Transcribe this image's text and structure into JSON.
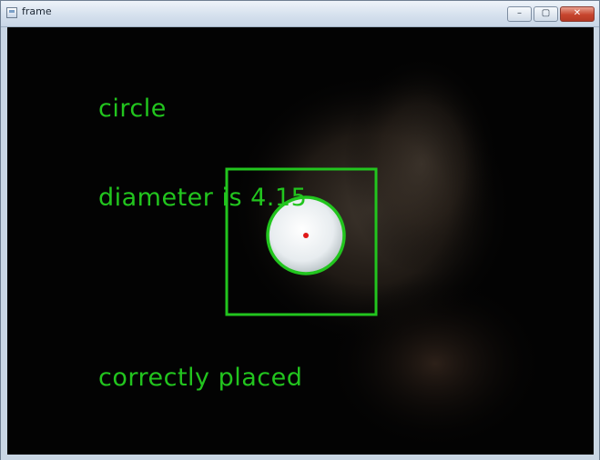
{
  "window": {
    "title": "frame",
    "controls": {
      "minimize": "–",
      "maximize": "▢",
      "close": "✕"
    }
  },
  "overlay": {
    "shape_label": "circle",
    "diameter_label": "diameter is 4.15",
    "status_label": "correctly placed"
  },
  "colors": {
    "overlay_green": "#22c51e",
    "center_marker": "#e01818",
    "frame_background": "#030303"
  },
  "icons": {
    "app": "window-app-icon",
    "minimize": "minimize-icon",
    "maximize": "maximize-icon",
    "close": "close-icon"
  }
}
